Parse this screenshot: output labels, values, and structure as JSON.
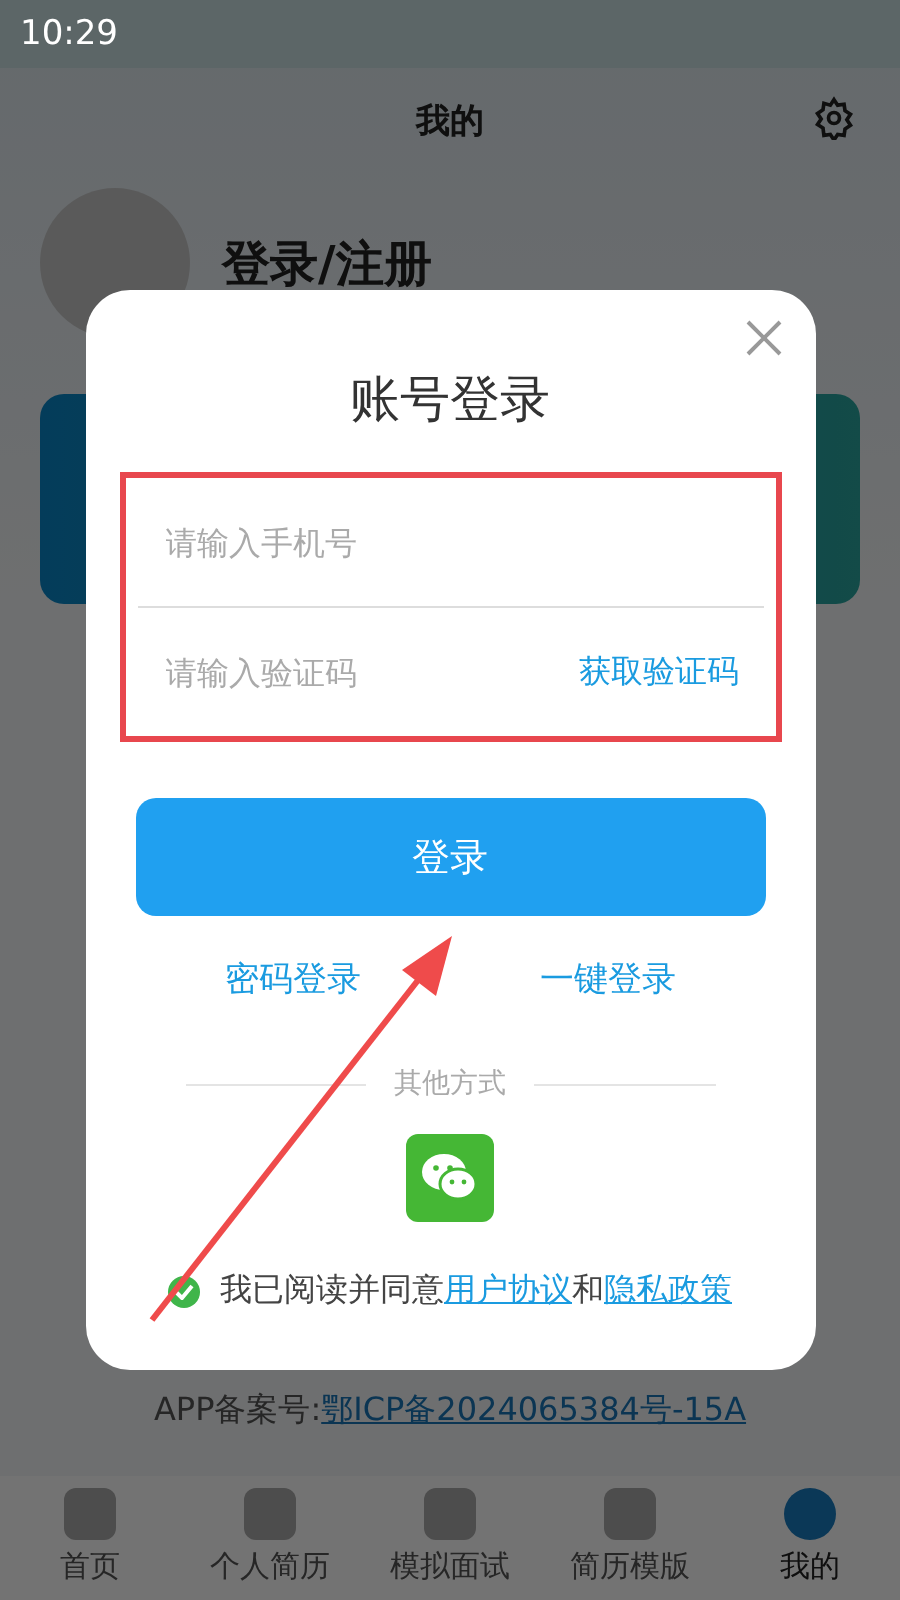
{
  "status_bar": {
    "time": "10:29"
  },
  "header": {
    "title": "我的"
  },
  "profile": {
    "name": "登录/注册"
  },
  "footer": {
    "label": "APP备案号:",
    "link": "鄂ICP备2024065384号-15A"
  },
  "tabs": [
    {
      "label": "首页",
      "selected": false
    },
    {
      "label": "个人简历",
      "selected": false
    },
    {
      "label": "模拟面试",
      "selected": false
    },
    {
      "label": "简历模版",
      "selected": false
    },
    {
      "label": "我的",
      "selected": true
    }
  ],
  "dialog": {
    "title": "账号登录",
    "phone_placeholder": "请输入手机号",
    "code_placeholder": "请输入验证码",
    "get_code": "获取验证码",
    "login_button": "登录",
    "alt_links": [
      "密码登录",
      "一键登录"
    ],
    "other_label": "其他方式",
    "agreement": {
      "checked": true,
      "text": "我已阅读并同意",
      "link1": "用户协议",
      "joiner": "和",
      "link2": "隐私政策"
    }
  }
}
